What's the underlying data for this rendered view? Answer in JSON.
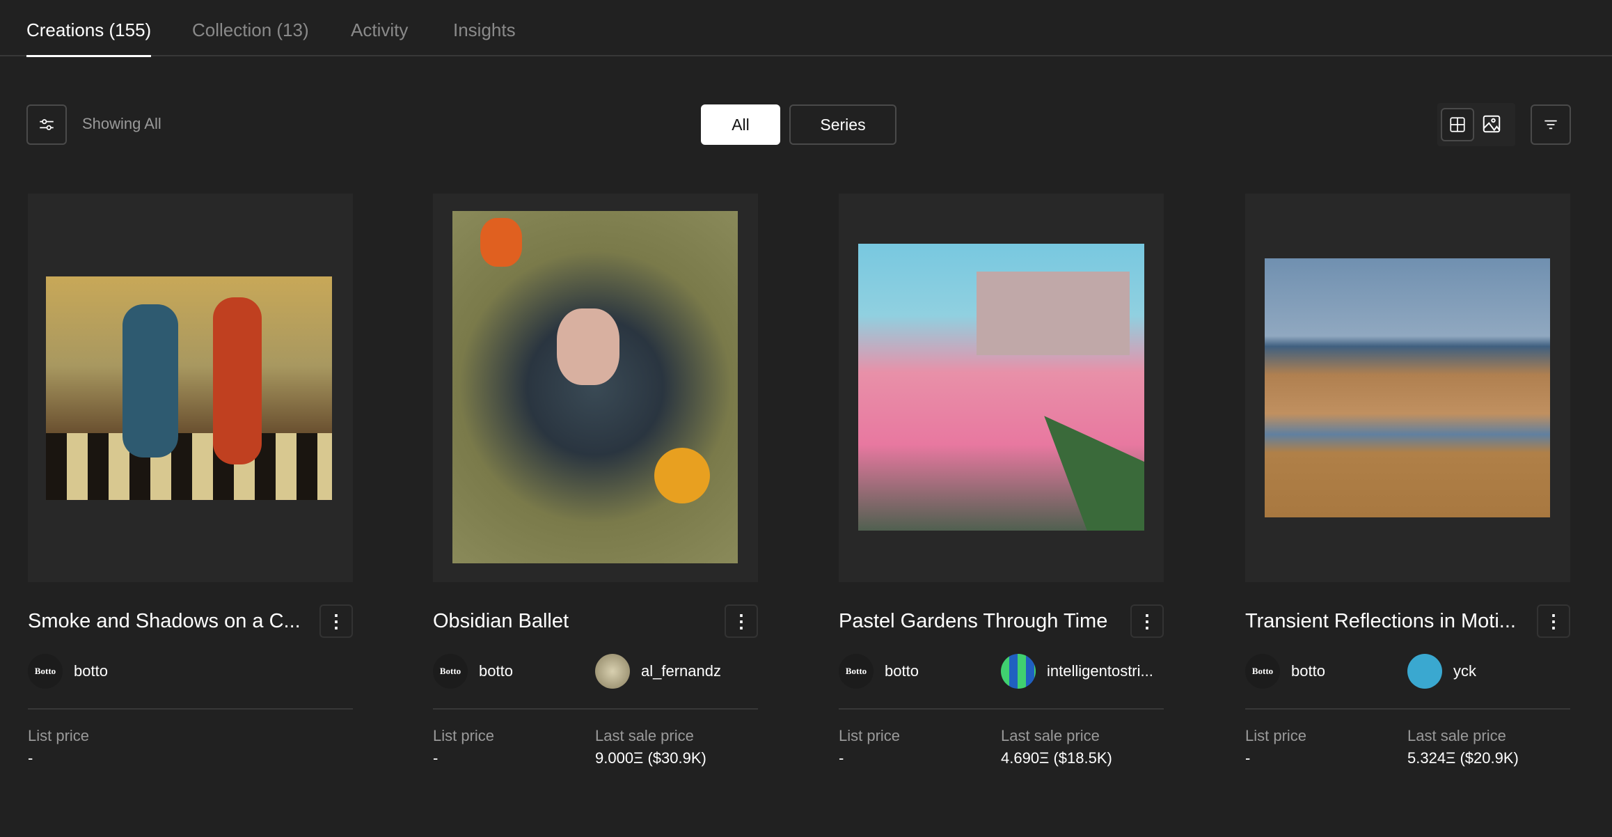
{
  "tabs": [
    {
      "label": "Creations (155)",
      "active": true
    },
    {
      "label": "Collection (13)"
    },
    {
      "label": "Activity"
    },
    {
      "label": "Insights"
    }
  ],
  "toolbar": {
    "filter_icon": "sliders-icon",
    "showing": "Showing All",
    "segments": [
      {
        "label": "All",
        "active": true
      },
      {
        "label": "Series"
      }
    ],
    "view_icons": [
      "grid-icon",
      "image-icon"
    ],
    "sort_icon": "sort-lines-icon"
  },
  "labels": {
    "list_price": "List price",
    "last_sale": "Last sale price"
  },
  "cards": [
    {
      "title": "Smoke and Shadows on a C...",
      "artist": "botto",
      "artist_logo": "Botto",
      "owner": "",
      "list_price": "-",
      "last_sale": ""
    },
    {
      "title": "Obsidian Ballet",
      "artist": "botto",
      "artist_logo": "Botto",
      "owner": "al_fernandz",
      "list_price": "-",
      "last_sale": "9.000Ξ ($30.9K)"
    },
    {
      "title": "Pastel Gardens Through Time",
      "artist": "botto",
      "artist_logo": "Botto",
      "owner": "intelligentostri...",
      "list_price": "-",
      "last_sale": "4.690Ξ ($18.5K)"
    },
    {
      "title": "Transient Reflections in Moti...",
      "artist": "botto",
      "artist_logo": "Botto",
      "owner": "yck",
      "list_price": "-",
      "last_sale": "5.324Ξ ($20.9K)"
    }
  ]
}
